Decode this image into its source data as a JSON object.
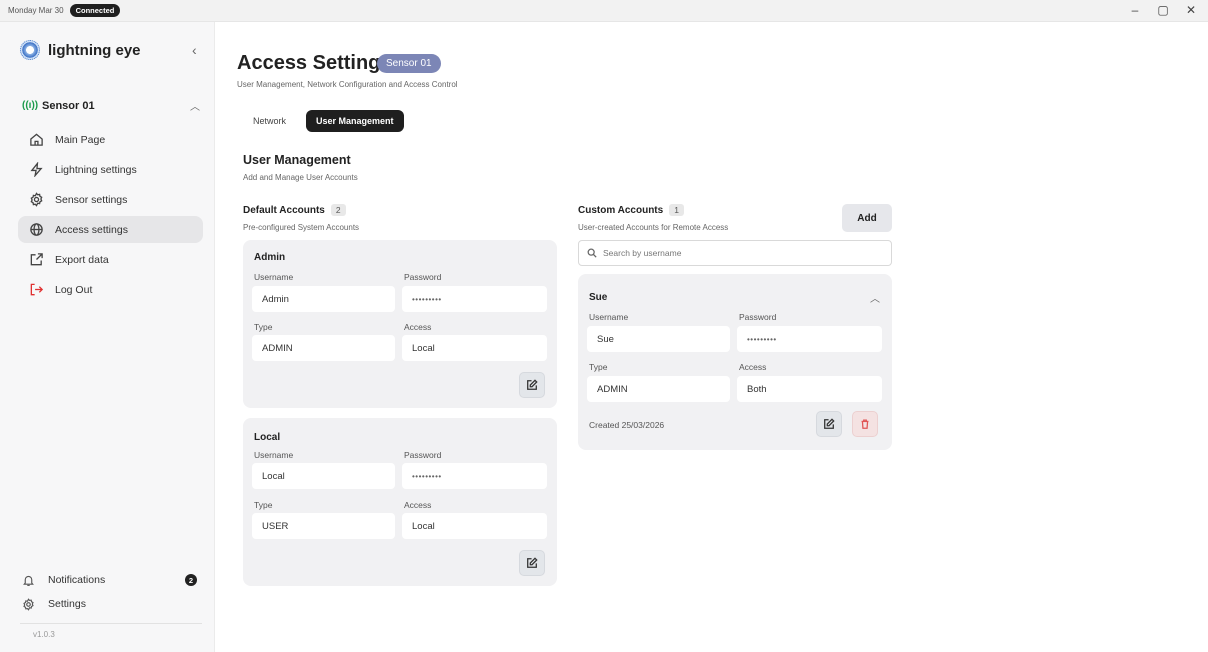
{
  "titlebar": {
    "date": "Monday Mar 30",
    "status": "Connected",
    "minimize": "–",
    "restore": "▢",
    "close": "✕"
  },
  "sidebar": {
    "brand": "lightning eye",
    "collapse_icon": "‹",
    "sensor_label": "Sensor 01",
    "sensor_icon": "((ı))",
    "sensor_chevron": "︿",
    "items": [
      {
        "label": "Main Page",
        "icon": "home-icon"
      },
      {
        "label": "Lightning settings",
        "icon": "bolt-icon"
      },
      {
        "label": "Sensor settings",
        "icon": "gear-icon"
      },
      {
        "label": "Access settings",
        "icon": "globe-icon",
        "active": true
      },
      {
        "label": "Export data",
        "icon": "export-icon"
      },
      {
        "label": "Log Out",
        "icon": "logout-icon",
        "color": "#e03030"
      }
    ],
    "notifications_label": "Notifications",
    "notifications_count": "2",
    "settings_label": "Settings",
    "version": "v1.0.3"
  },
  "header": {
    "title": "Access Settings",
    "sensor_badge": "Sensor 01",
    "subtitle": "User Management, Network Configuration and Access Control"
  },
  "tabs": [
    {
      "label": "Network",
      "active": false
    },
    {
      "label": "User Management",
      "active": true
    }
  ],
  "section": {
    "title": "User Management",
    "subtitle": "Add and Manage User Accounts"
  },
  "default_accounts": {
    "title": "Default Accounts",
    "count": "2",
    "subtitle": "Pre-configured System Accounts",
    "cards": [
      {
        "name": "Admin",
        "username_label": "Username",
        "password_label": "Password",
        "username": "Admin",
        "password": "•••••••••",
        "type_label": "Type",
        "access_label": "Access",
        "type": "ADMIN",
        "access": "Local"
      },
      {
        "name": "Local",
        "username_label": "Username",
        "password_label": "Password",
        "username": "Local",
        "password": "•••••••••",
        "type_label": "Type",
        "access_label": "Access",
        "type": "USER",
        "access": "Local"
      }
    ]
  },
  "custom_accounts": {
    "title": "Custom Accounts",
    "count": "1",
    "subtitle": "User-created Accounts for Remote Access",
    "add_label": "Add",
    "search_placeholder": "Search by username",
    "cards": [
      {
        "name": "Sue",
        "username_label": "Username",
        "password_label": "Password",
        "username": "Sue",
        "password": "•••••••••",
        "type_label": "Type",
        "access_label": "Access",
        "type": "ADMIN",
        "access": "Both",
        "created": "Created 25/03/2026",
        "chevron": "︿"
      }
    ]
  },
  "colors": {
    "accent_badge": "#7c86b6",
    "active_tab": "#1f1f1f",
    "connected_badge": "#1f1f1f",
    "logout": "#e03030",
    "delete": "#e05555"
  }
}
